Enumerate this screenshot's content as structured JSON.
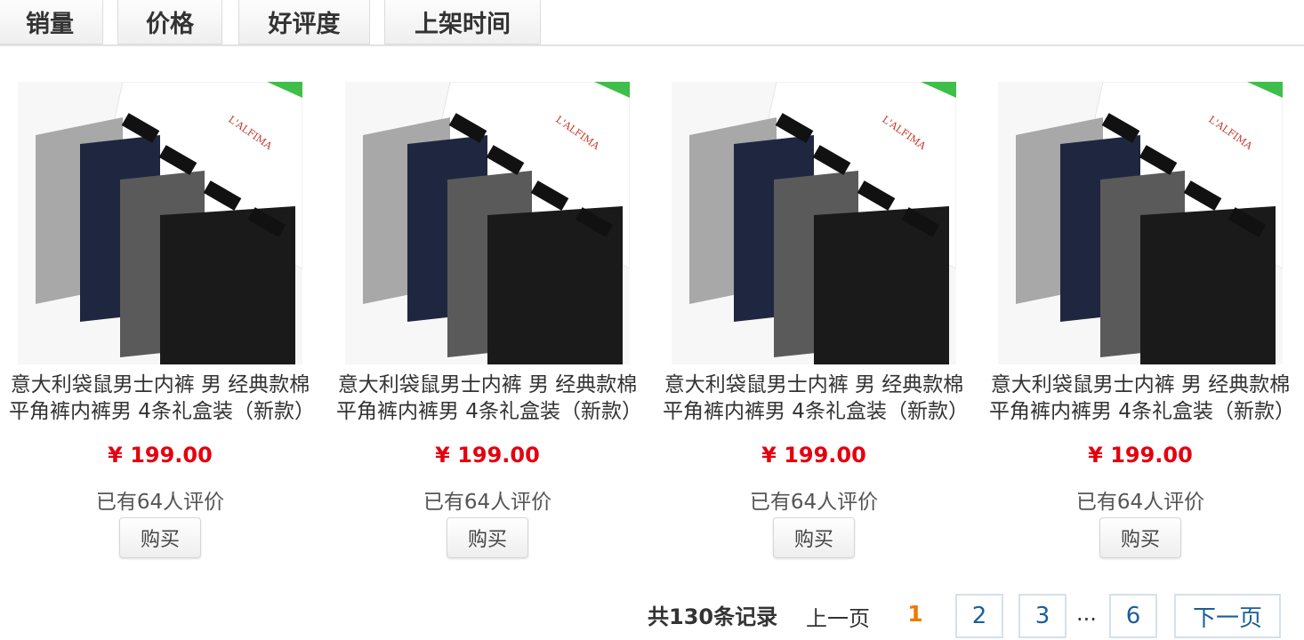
{
  "sort_tabs": [
    "销量",
    "价格",
    "好评度",
    "上架时间"
  ],
  "products": [
    {
      "title": "意大利袋鼠男士内裤 男 经典款棉平角裤内裤男 4条礼盒装（新款）",
      "price": "¥ 199.00",
      "reviews": "已有64人评价",
      "buy_label": "购买",
      "brand_text": "L'ALFIMA"
    },
    {
      "title": "意大利袋鼠男士内裤 男 经典款棉平角裤内裤男 4条礼盒装（新款）",
      "price": "¥ 199.00",
      "reviews": "已有64人评价",
      "buy_label": "购买",
      "brand_text": "L'ALFIMA"
    },
    {
      "title": "意大利袋鼠男士内裤 男 经典款棉平角裤内裤男 4条礼盒装（新款）",
      "price": "¥ 199.00",
      "reviews": "已有64人评价",
      "buy_label": "购买",
      "brand_text": "L'ALFIMA"
    },
    {
      "title": "意大利袋鼠男士内裤 男 经典款棉平角裤内裤男 4条礼盒装（新款）",
      "price": "¥ 199.00",
      "reviews": "已有64人评价",
      "buy_label": "购买",
      "brand_text": "L'ALFIMA"
    }
  ],
  "pagination": {
    "total": "共130条记录",
    "prev": "上一页",
    "current": "1",
    "pages": [
      "2",
      "3",
      "6"
    ],
    "ellipsis": "...",
    "next": "下一页"
  },
  "colors": {
    "price": "#e4000f",
    "current_page": "#f07800",
    "page_link": "#1a5f9a",
    "box_accent": "#3fbe4a"
  }
}
